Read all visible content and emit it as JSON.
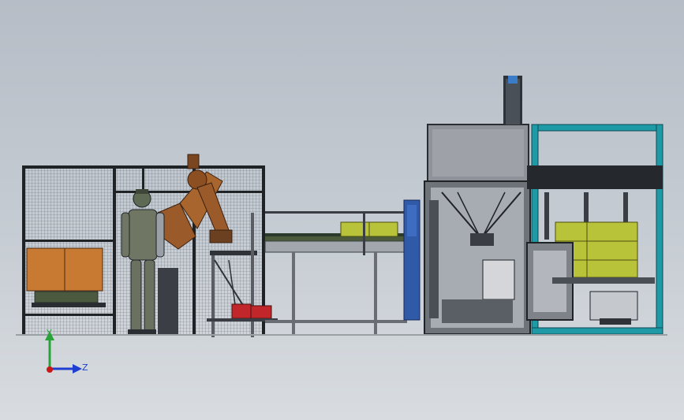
{
  "triad": {
    "y_label": "Y",
    "z_label": "Z"
  },
  "colors": {
    "frame": "#1f2326",
    "mesh": "#5a6068",
    "teal_frame": "#1e9aa6",
    "carton": "#b9c33a",
    "wood_case": "#c87a33",
    "robot": "#9a5a2a",
    "motor": "#c0262a",
    "panel_blue": "#2f5aa8",
    "housing": "#8f9299",
    "axis_y": "#2aa33a",
    "axis_z": "#1f3fd0",
    "axis_origin": "#c81818"
  }
}
